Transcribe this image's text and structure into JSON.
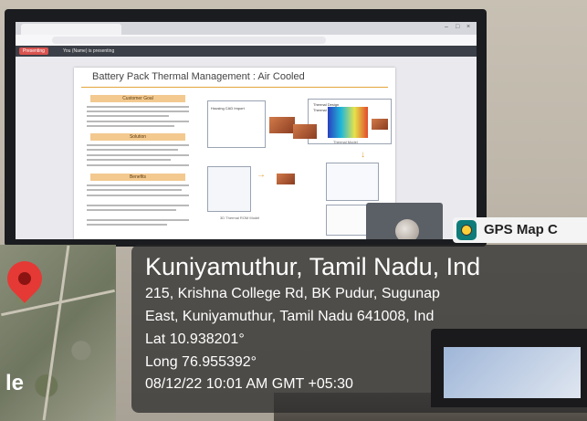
{
  "screen": {
    "tab_title": "",
    "url": "",
    "presenting_chip": "Presenting",
    "presenting_text": "You (Name) is presenting"
  },
  "slide": {
    "title": "Battery Pack Thermal Management : Air Cooled",
    "left_headers": [
      "Customer Goal",
      "Solution",
      "Benefits"
    ],
    "bullets": [
      "Housing CAD Import",
      "Thermal Design",
      "Thermal model generation",
      "Thermal Model",
      "3D Thermal ROM Model"
    ]
  },
  "gps": {
    "badge": "GPS Map C",
    "title": "Kuniyamuthur, Tamil Nadu, Ind",
    "address_line1": "215, Krishna College Rd, BK Pudur, Sugunap",
    "address_line2": "East, Kuniyamuthur, Tamil Nadu 641008, Ind",
    "lat": "Lat 10.938201°",
    "long": "Long 76.955392°",
    "datetime": "08/12/22 10:01 AM GMT +05:30",
    "map_logo_fragment": "le"
  },
  "colors": {
    "pin": "#e53935",
    "overlay": "#282828",
    "slide_accent": "#e3a53a"
  }
}
